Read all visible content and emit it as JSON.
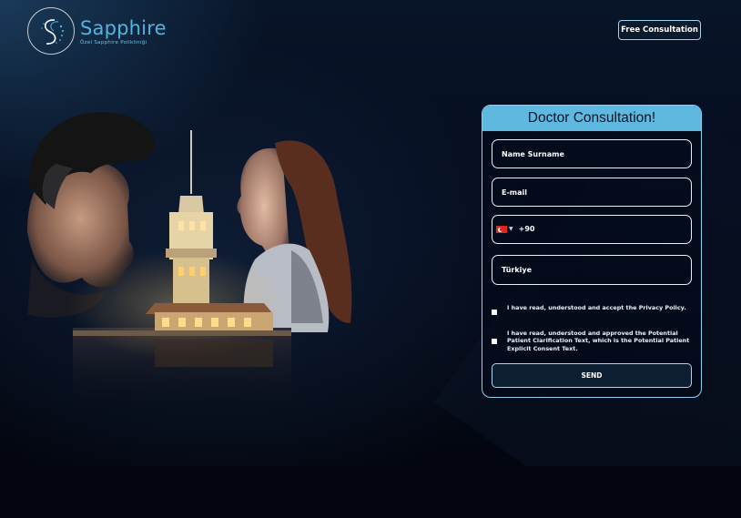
{
  "header": {
    "brand_name": "Sapphire",
    "brand_subtitle": "Özel Sapphire Polikliniği",
    "cta_label": "Free Consultation"
  },
  "form": {
    "title": "Doctor Consultation!",
    "name_placeholder": "Name Surname",
    "email_placeholder": "E-mail",
    "phone_country_code": "+90",
    "phone_flag": "turkey-flag-icon",
    "country_value": "Türkiye",
    "checkbox_privacy": "I have read, understood and accept the Privacy Policy.",
    "checkbox_consent": "I have read, understood and approved the Potential Patient Clarification Text, which is the Potential Patient Explicit Consent Text.",
    "send_label": "SEND"
  },
  "colors": {
    "accent": "#5fb8df",
    "brand": "#4fb6e0",
    "background": "#050b1c"
  }
}
